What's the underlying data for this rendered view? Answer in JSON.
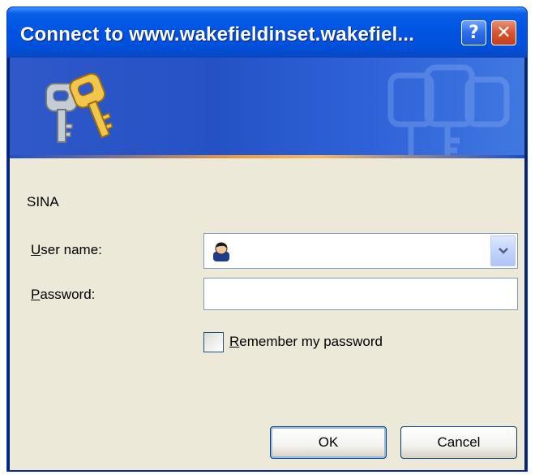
{
  "dialog": {
    "title": "Connect to www.wakefieldinset.wakefiel...",
    "help_button": "?",
    "close_button": "✕",
    "realm": "SINA",
    "username_label_access": "U",
    "username_label_rest": "ser name:",
    "username_value": "",
    "password_label_access": "P",
    "password_label_rest": "assword:",
    "password_value": "",
    "remember_label_access": "R",
    "remember_label_rest": "emember my password",
    "remember_checked": false,
    "ok_label": "OK",
    "cancel_label": "Cancel"
  },
  "icons": {
    "banner": "keys-icon",
    "watermark": "keys-watermark-icon",
    "user_avatar": "user-avatar-icon",
    "dropdown": "chevron-down-icon"
  },
  "colors": {
    "titlebar": "#0054e3",
    "dialog_bg": "#ece9d8",
    "banner_accent": "#f09a3e",
    "close_button": "#d9532e"
  }
}
